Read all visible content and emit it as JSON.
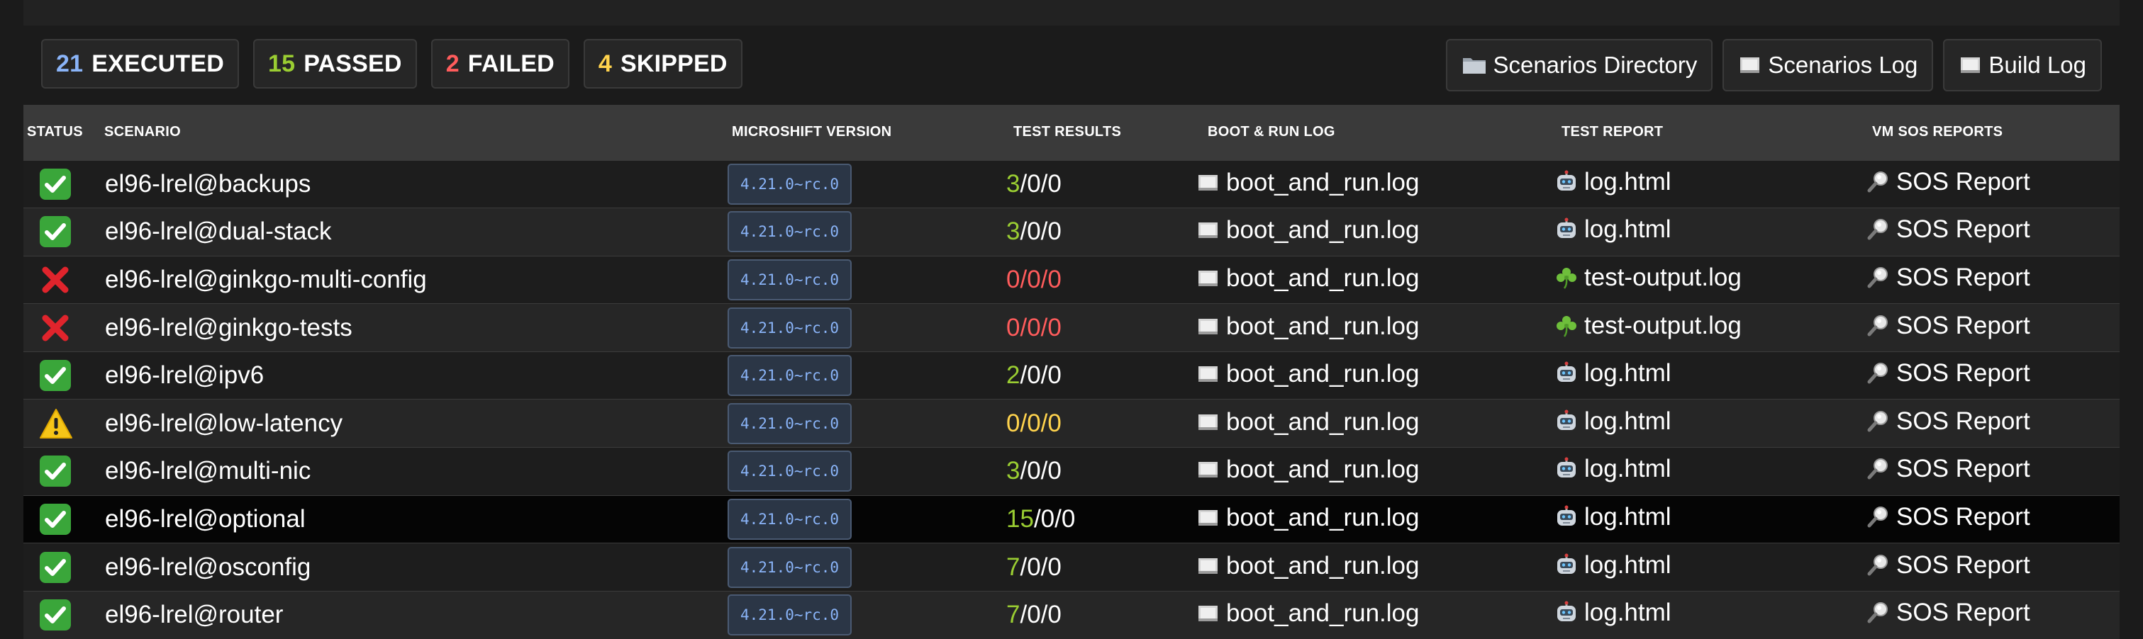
{
  "summary": {
    "executed": {
      "count": "21",
      "label": "EXECUTED"
    },
    "passed": {
      "count": "15",
      "label": "PASSED"
    },
    "failed": {
      "count": "2",
      "label": "FAILED"
    },
    "skipped": {
      "count": "4",
      "label": "SKIPPED"
    }
  },
  "links": {
    "scenarios_directory": "Scenarios Directory",
    "scenarios_log": "Scenarios Log",
    "build_log": "Build Log"
  },
  "columns": [
    "STATUS",
    "SCENARIO",
    "MICROSHIFT VERSION",
    "TEST RESULTS",
    "BOOT & RUN LOG",
    "TEST REPORT",
    "VM SOS REPORTS"
  ],
  "rows": [
    {
      "status": "pass",
      "scenario": "el96-lrel@backups",
      "version": "4.21.0~rc.0",
      "passed": "3",
      "rest": "/0/0",
      "result_class": "pass",
      "boot_log": "boot_and_run.log",
      "report_type": "robot",
      "report": "log.html",
      "sos": "SOS Report"
    },
    {
      "status": "pass",
      "scenario": "el96-lrel@dual-stack",
      "version": "4.21.0~rc.0",
      "passed": "3",
      "rest": "/0/0",
      "result_class": "pass",
      "boot_log": "boot_and_run.log",
      "report_type": "robot",
      "report": "log.html",
      "sos": "SOS Report"
    },
    {
      "status": "fail",
      "scenario": "el96-lrel@ginkgo-multi-config",
      "version": "4.21.0~rc.0",
      "passed": "0/0/0",
      "rest": "",
      "result_class": "fail",
      "boot_log": "boot_and_run.log",
      "report_type": "ginkgo",
      "report": "test-output.log",
      "sos": "SOS Report"
    },
    {
      "status": "fail",
      "scenario": "el96-lrel@ginkgo-tests",
      "version": "4.21.0~rc.0",
      "passed": "0/0/0",
      "rest": "",
      "result_class": "fail",
      "boot_log": "boot_and_run.log",
      "report_type": "ginkgo",
      "report": "test-output.log",
      "sos": "SOS Report"
    },
    {
      "status": "pass",
      "scenario": "el96-lrel@ipv6",
      "version": "4.21.0~rc.0",
      "passed": "2",
      "rest": "/0/0",
      "result_class": "pass",
      "boot_log": "boot_and_run.log",
      "report_type": "robot",
      "report": "log.html",
      "sos": "SOS Report"
    },
    {
      "status": "warn",
      "scenario": "el96-lrel@low-latency",
      "version": "4.21.0~rc.0",
      "passed": "0/0/0",
      "rest": "",
      "result_class": "warn",
      "boot_log": "boot_and_run.log",
      "report_type": "robot",
      "report": "log.html",
      "sos": "SOS Report"
    },
    {
      "status": "pass",
      "scenario": "el96-lrel@multi-nic",
      "version": "4.21.0~rc.0",
      "passed": "3",
      "rest": "/0/0",
      "result_class": "pass",
      "boot_log": "boot_and_run.log",
      "report_type": "robot",
      "report": "log.html",
      "sos": "SOS Report"
    },
    {
      "status": "pass",
      "scenario": "el96-lrel@optional",
      "version": "4.21.0~rc.0",
      "passed": "15",
      "rest": "/0/0",
      "result_class": "pass",
      "boot_log": "boot_and_run.log",
      "report_type": "robot",
      "report": "log.html",
      "sos": "SOS Report",
      "highlight": true
    },
    {
      "status": "pass",
      "scenario": "el96-lrel@osconfig",
      "version": "4.21.0~rc.0",
      "passed": "7",
      "rest": "/0/0",
      "result_class": "pass",
      "boot_log": "boot_and_run.log",
      "report_type": "robot",
      "report": "log.html",
      "sos": "SOS Report"
    },
    {
      "status": "pass",
      "scenario": "el96-lrel@router",
      "version": "4.21.0~rc.0",
      "passed": "7",
      "rest": "/0/0",
      "result_class": "pass",
      "boot_log": "boot_and_run.log",
      "report_type": "robot",
      "report": "log.html",
      "sos": "SOS Report"
    }
  ],
  "colors": {
    "pass": "#9acd32",
    "fail": "#ff5c5c",
    "warn": "#ffd34d",
    "info": "#8ab4f8",
    "accent_check": "#3aa63a"
  },
  "icons": {
    "pass": "check-icon",
    "fail": "cross-icon",
    "warn": "warning-icon",
    "folder": "folder-icon",
    "log": "log-icon",
    "robot": "robot-icon",
    "ginkgo": "clover-icon",
    "sos": "magnifier-icon"
  }
}
